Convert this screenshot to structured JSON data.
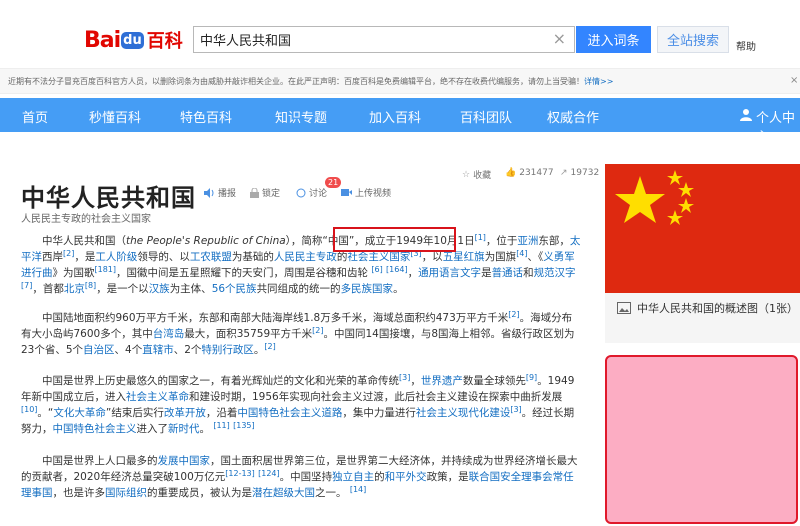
{
  "header": {
    "logo_bai": "Bai",
    "logo_du": "du",
    "logo_baike": "百科",
    "search_value": "中华人民共和国",
    "enter_button": "进入词条",
    "site_search_button": "全站搜索",
    "help_link": "帮助"
  },
  "notice": {
    "text": "近期有不法分子冒充百度百科官方人员，以删除词条为由威胁并敲诈相关企业。在此严正声明：百度百科是免费编辑平台，绝不存在收费代编服务，请勿上当受骗！",
    "more": "详情>>"
  },
  "nav": {
    "items": [
      "首页",
      "秒懂百科",
      "特色百科",
      "知识专题",
      "加入百科",
      "百科团队",
      "权威合作"
    ],
    "user_center": "个人中心"
  },
  "entry": {
    "title": "中华人民共和国",
    "subtitle": "人民民主专政的社会主义国家",
    "tools": {
      "broadcast": "播报",
      "lock": "锁定",
      "discuss": "讨论",
      "discuss_count": "21",
      "upload_video": "上传视频"
    },
    "stats": {
      "favorite": "收藏",
      "likes": "231477",
      "shares": "19732"
    }
  },
  "paragraphs": {
    "p1": {
      "a": "中华人民共和国（",
      "en": "the People's Republic of China",
      "b": "），简称“中国”，",
      "founded": "成立于1949年10月1日",
      "r1": "[1]",
      "c": "，位于",
      "l_asia": "亚洲",
      "d": "东部，",
      "l_pacific": "太平洋",
      "e": "西岸",
      "r2": "[2]",
      "f": "，是",
      "l_worker": "工人阶级",
      "g": "领导的、以",
      "l_alliance": "工农联盟",
      "h": "为基础的",
      "l_dictatorship": "人民民主专政",
      "i": "的",
      "l_socialist": "社会主义国家",
      "r3": "[3]",
      "j": "，以",
      "l_flag": "五星红旗",
      "k": "为国旗",
      "r4": "[4]",
      "l": "、《",
      "l_anthem": "义勇军进行曲",
      "m": "》为国歌",
      "r5": "[181]",
      "n": "，国徽中间是五星照耀下的天安门，周围是谷穗和齿轮",
      "r6": "[6]",
      "r7": "[164]",
      "o": "，",
      "l_script": "通用语言文字",
      "p": "是",
      "l_mandarin": "普通话",
      "q": "和",
      "l_hanzi": "规范汉字",
      "r8": "[7]",
      "r": "，首都",
      "l_beijing": "北京",
      "r9": "[8]",
      "s": "，是一个以",
      "l_han": "汉族",
      "t": "为主体、",
      "l_56": "56个民族",
      "u": "共同组成的统一的",
      "l_multi": "多民族国家",
      "v": "。"
    },
    "p2": {
      "a": "中国陆地面积约960万平方千米，东部和南部大陆海岸线1.8万多千米，海域总面积约473万平方千米",
      "r1": "[2]",
      "b": "。海域分布有大小岛屿7600多个，其中",
      "l_taiwan": "台湾岛",
      "c": "最大，面积35759平方千米",
      "r2": "[2]",
      "d": "。中国同14国接壤，与8国海上相邻。省级行政区划为23个省、5个",
      "l_auto": "自治区",
      "e": "、4个",
      "l_muni": "直辖市",
      "f": "、2个",
      "l_sar": "特别行政区",
      "g": "。",
      "r3": "[2]"
    },
    "p3": {
      "a": "中国是世界上历史最悠久的国家之一，有着光辉灿烂的文化和光荣的革命传统",
      "r1": "[3]",
      "b": "，",
      "l_heritage": "世界遗产",
      "c": "数量全球领先",
      "r2": "[9]",
      "d": "。1949年新中国成立后，进入",
      "l_revolution": "社会主义革命",
      "e": "和建设时期，1956年实现向社会主义过渡，此后社会主义建设在探索中曲折发展",
      "r3": "[10]",
      "f": "。“",
      "l_cr": "文化大革命",
      "g": "”结束后实行",
      "l_reform": "改革开放",
      "h": "，沿着",
      "l_path": "中国特色社会主义道路",
      "i": "，集中力量进行",
      "l_modern": "社会主义现代化建设",
      "r4": "[3]",
      "j": "。经过长期努力，",
      "l_socialism": "中国特色社会主义",
      "k": "进入了",
      "l_newera": "新时代",
      "l": "。",
      "r5": "[11]",
      "r6": "[135]"
    },
    "p4": {
      "a": "中国是世界上人口最多的",
      "l_dev": "发展中国家",
      "b": "，国土面积居世界第三位，是世界第二大经济体，并持续成为世界经济增长最大的贡献者，2020年经济总量突破100万亿元",
      "r1": "[12-13]",
      "r2": "[124]",
      "c": "。中国坚持",
      "l_indep": "独立自主",
      "d": "的",
      "l_peace": "和平外交",
      "e": "政策，是",
      "l_unsc": "联合国安全理事会常任理事国",
      "f": "，也是许多",
      "l_intl": "国际组织",
      "g": "的重要成员，被认为是",
      "l_super": "潜在超级大国",
      "h": "之一。",
      "r3": "[14]"
    }
  },
  "sidebar": {
    "album_text": "中华人民共和国的概述图（1张）"
  },
  "colors": {
    "nav_blue": "#459df5",
    "link_blue": "#136ec2",
    "flag_red": "#de2910",
    "flag_star": "#ffde00",
    "highlight_red": "#d8131b",
    "pink_fill": "#fcadc3"
  }
}
